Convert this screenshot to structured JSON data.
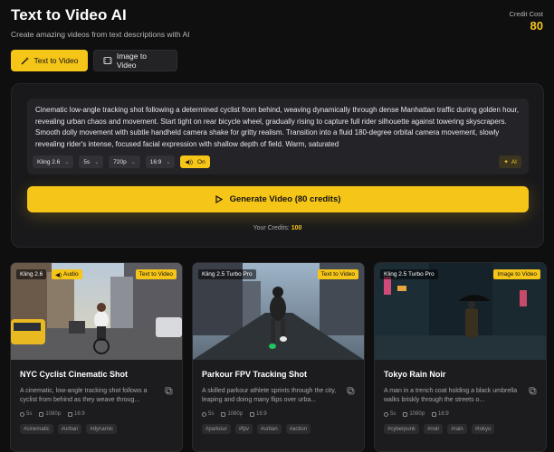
{
  "header": {
    "title": "Text to Video AI",
    "subtitle": "Create amazing videos from text descriptions with AI"
  },
  "cost": {
    "label": "Credit Cost",
    "value": "80"
  },
  "tabs": [
    {
      "label": "Text to Video",
      "icon": "magic-wand-icon",
      "active": true
    },
    {
      "label": "Image to Video",
      "icon": "film-icon",
      "active": false
    }
  ],
  "prompt": {
    "text": "Cinematic low-angle tracking shot following a determined cyclist from behind, weaving dynamically through dense Manhattan traffic during golden hour, revealing urban chaos and movement. Start tight on rear bicycle wheel, gradually rising to capture full rider silhouette against towering skyscrapers. Smooth dolly movement with subtle handheld camera shake for gritty realism. Transition into a fluid 180-degree orbital camera movement, slowly revealing rider's intense, focused facial expression with shallow depth of field. Warm, saturated"
  },
  "controls": {
    "model": "Kling 2.6",
    "duration": "5s",
    "resolution": "720p",
    "aspect": "16:9",
    "audio_toggle": "On",
    "ai_button": "AI"
  },
  "generate": {
    "label": "Generate Video (80 credits)"
  },
  "credits": {
    "label": "Your Credits:",
    "value": "100"
  },
  "accent": "#f5c518",
  "cards": [
    {
      "model": "Kling 2.6",
      "audio": "Audio",
      "type": "Text to Video",
      "title": "NYC Cyclist Cinematic Shot",
      "description": "A cinematic, low-angle tracking shot follows a cyclist from behind as they weave throug...",
      "duration": "5s",
      "resolution": "1080p",
      "aspect": "16:9",
      "tags": [
        "#cinematic",
        "#urban",
        "#dynamic"
      ]
    },
    {
      "model": "Kling 2.5 Turbo Pro",
      "type": "Text to Video",
      "title": "Parkour FPV Tracking Shot",
      "description": "A skilled parkour athlete sprints through the city, leaping and doing many flips over urba...",
      "duration": "5s",
      "resolution": "1080p",
      "aspect": "16:9",
      "tags": [
        "#parkour",
        "#fpv",
        "#urban",
        "#action"
      ]
    },
    {
      "model": "Kling 2.5 Turbo Pro",
      "type": "Image to Video",
      "title": "Tokyo Rain Noir",
      "description": "A man in a trench coat holding a black umbrella walks briskly through the streets o...",
      "duration": "5s",
      "resolution": "1080p",
      "aspect": "16:9",
      "tags": [
        "#cyberpunk",
        "#noir",
        "#rain",
        "#tokyo"
      ]
    }
  ]
}
